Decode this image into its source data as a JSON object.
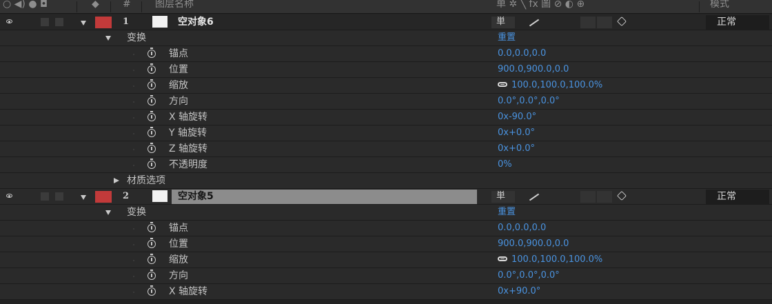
{
  "header": {
    "icons": [
      "eye-icon",
      "audio-icon",
      "solo-icon",
      "lock-icon",
      "label-icon"
    ],
    "col_num": "#",
    "col_name": "图层名称",
    "col_switches": "单 ✲ ╲ fx 圖 ⊘ ◐ ⊕",
    "col_mode": "模式"
  },
  "colors": {
    "label_red": "#c23a3a",
    "value_blue": "#4a93e0",
    "panel_bg": "#232323"
  },
  "layers": [
    {
      "index": "1",
      "name": "空对象6",
      "selected": false,
      "mode": "正常",
      "transform_label": "变换",
      "transform_reset": "重置",
      "props": [
        {
          "name": "锚点",
          "value": "0.0,0.0,0.0"
        },
        {
          "name": "位置",
          "value": "900.0,900.0,0.0"
        },
        {
          "name": "缩放",
          "value": "100.0,100.0,100.0%",
          "linked": true
        },
        {
          "name": "方向",
          "value": "0.0°,0.0°,0.0°"
        },
        {
          "name": "X 轴旋转",
          "value": "0x-90.0°"
        },
        {
          "name": "Y 轴旋转",
          "value": "0x+0.0°"
        },
        {
          "name": "Z 轴旋转",
          "value": "0x+0.0°"
        },
        {
          "name": "不透明度",
          "value": "0%"
        }
      ],
      "material_label": "材质选项"
    },
    {
      "index": "2",
      "name": "空对象5",
      "selected": true,
      "mode": "正常",
      "transform_label": "变换",
      "transform_reset": "重置",
      "props": [
        {
          "name": "锚点",
          "value": "0.0,0.0,0.0"
        },
        {
          "name": "位置",
          "value": "900.0,900.0,0.0"
        },
        {
          "name": "缩放",
          "value": "100.0,100.0,100.0%",
          "linked": true
        },
        {
          "name": "方向",
          "value": "0.0°,0.0°,0.0°"
        },
        {
          "name": "X 轴旋转",
          "value": "0x+90.0°"
        }
      ]
    }
  ],
  "switch_shy_glyph": "単"
}
